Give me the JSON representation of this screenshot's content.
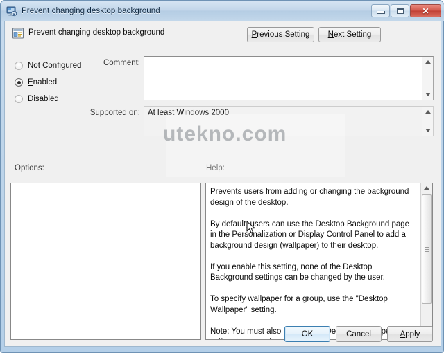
{
  "window": {
    "title": "Prevent changing desktop background",
    "icon": "policy-monitor-icon",
    "controls": {
      "minimize": "Minimize",
      "maximize": "Maximize",
      "close": "Close",
      "close_glyph": "✕"
    }
  },
  "header": {
    "icon": "policy-setting-icon",
    "title": "Prevent changing desktop background",
    "previous_button": {
      "pre": "P",
      "rest": "revious Setting"
    },
    "next_button": {
      "pre": "N",
      "rest": "ext Setting"
    }
  },
  "state": {
    "options": [
      {
        "label_pre": "Not ",
        "label_acc": "C",
        "label_post": "onfigured",
        "selected": false,
        "name": "not-configured"
      },
      {
        "label_pre": "",
        "label_acc": "E",
        "label_post": "nabled",
        "selected": true,
        "name": "enabled"
      },
      {
        "label_pre": "",
        "label_acc": "D",
        "label_post": "isabled",
        "selected": false,
        "name": "disabled"
      }
    ]
  },
  "fields": {
    "comment_label": "Comment:",
    "comment_value": "",
    "supported_label": "Supported on:",
    "supported_value": "At least Windows 2000"
  },
  "panels": {
    "options_label": "Options:",
    "help_label": "Help:",
    "options_content": "",
    "help_paragraphs": [
      "Prevents users from adding or changing the background design of the desktop.",
      "By default, users can use the Desktop Background page in the Personalization or Display Control Panel to add a background design (wallpaper) to their desktop.",
      "If you enable this setting, none of the Desktop Background settings can be changed by the user.",
      "To specify wallpaper for a group, use the \"Desktop Wallpaper\" setting.",
      "Note: You must also enable the \"Desktop Wallpaper\" setting to prevent users from changing the desktop wallpaper. Refer to KB"
    ]
  },
  "footer": {
    "ok": "OK",
    "cancel": "Cancel",
    "apply_pre": "A",
    "apply_rest": "pply"
  },
  "watermark": {
    "text": "utekno.com"
  },
  "colors": {
    "titlebar": "#c2d6ea",
    "frame": "#b4cfe8",
    "client": "#f0f0f0",
    "close_button": "#c03f34",
    "default_button_border": "#3c7fb1",
    "text": "#0d0d0d"
  }
}
